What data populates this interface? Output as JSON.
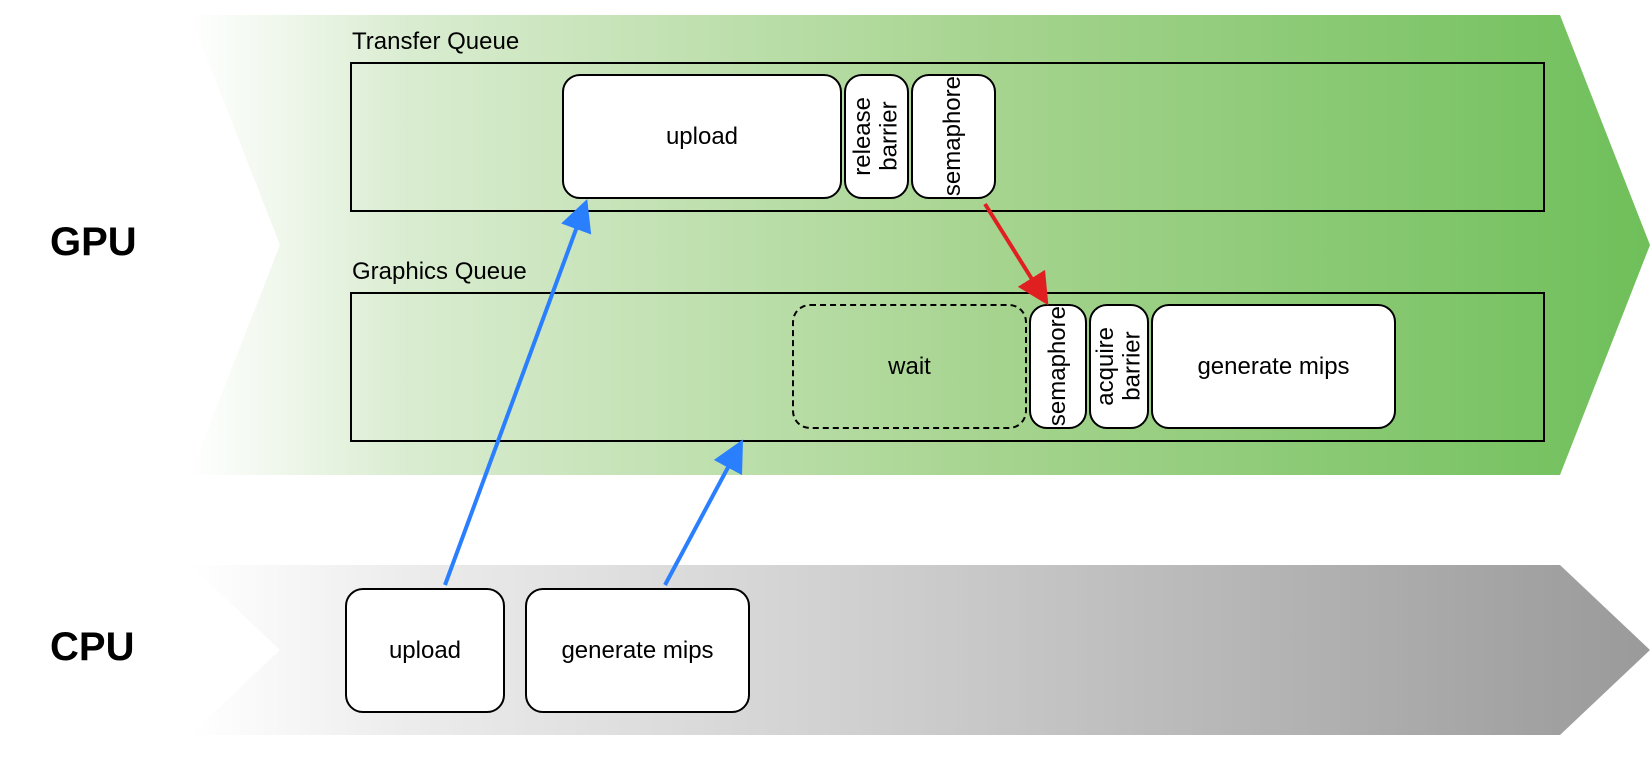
{
  "lanes": {
    "gpu": {
      "label": "GPU"
    },
    "cpu": {
      "label": "CPU"
    }
  },
  "queues": {
    "transfer": {
      "label": "Transfer Queue"
    },
    "graphics": {
      "label": "Graphics Queue"
    }
  },
  "nodes": {
    "tq_upload": "upload",
    "tq_release_barrier": "release\nbarrier",
    "tq_semaphore": "semaphore",
    "gq_wait": "wait",
    "gq_semaphore": "semaphore",
    "gq_acquire_barrier": "acquire\nbarrier",
    "gq_generate_mips": "generate mips",
    "cpu_upload": "upload",
    "cpu_generate_mips": "generate mips"
  },
  "arrows": {
    "cpu_upload_to_tq": {
      "color": "#2a7fff"
    },
    "cpu_genmips_to_gq": {
      "color": "#2a7fff"
    },
    "tq_sem_to_gq_sem": {
      "color": "#e02020"
    }
  },
  "colors": {
    "gpu_band_start": "#ffffff",
    "gpu_band_end": "#6fbf5a",
    "cpu_band_start": "#ffffff",
    "cpu_band_end": "#9a9a9a"
  }
}
